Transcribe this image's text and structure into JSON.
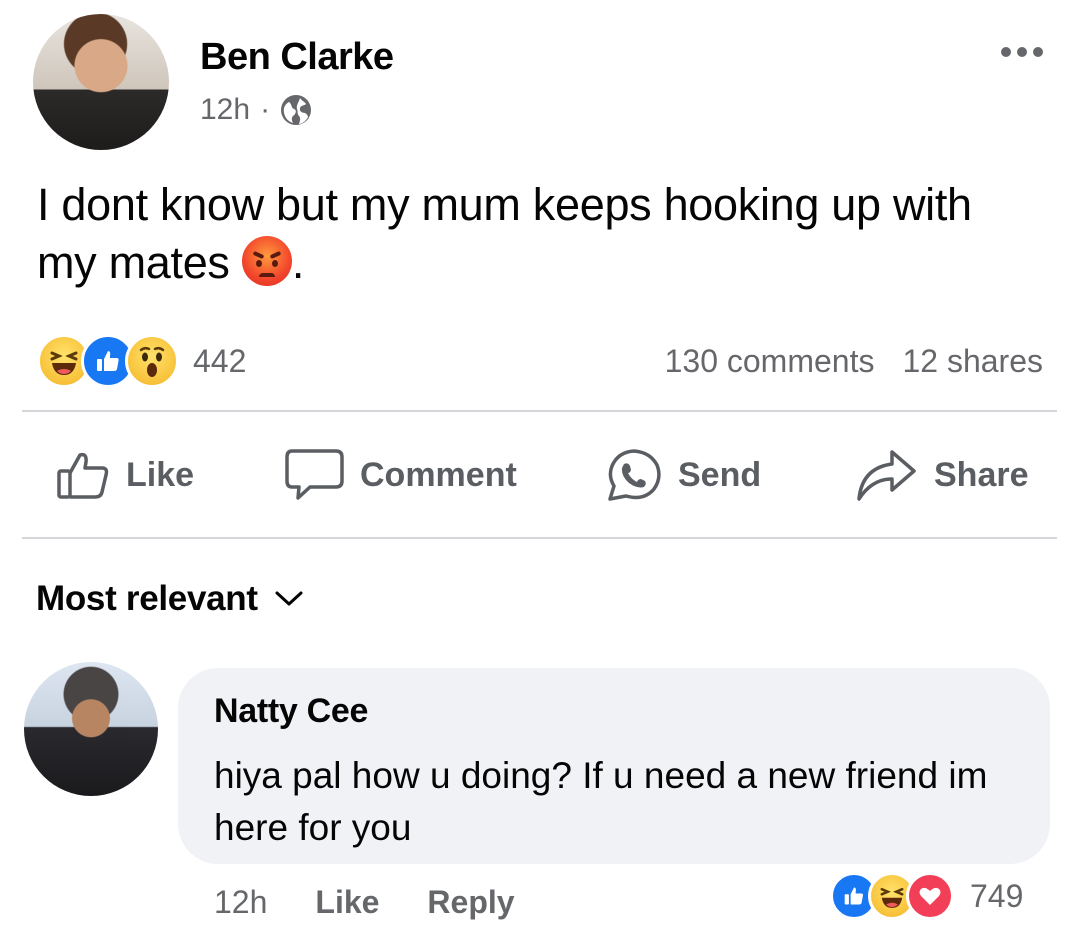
{
  "post": {
    "author": "Ben Clarke",
    "time": "12h",
    "dot": "·",
    "text": "I dont know but my mum keeps hooking up with my mates",
    "text_end": ".",
    "reactions": [
      "haha",
      "like",
      "wow"
    ],
    "reaction_count": "442",
    "comments_count": "130 comments",
    "shares_count": "12 shares"
  },
  "actions": {
    "like": "Like",
    "comment": "Comment",
    "send": "Send",
    "share": "Share"
  },
  "sort": {
    "label": "Most relevant"
  },
  "comment": {
    "author": "Natty Cee",
    "text": "hiya pal how u doing? If u need a new friend im here for you",
    "time": "12h",
    "like": "Like",
    "reply": "Reply",
    "reactions": [
      "like",
      "haha",
      "love"
    ],
    "reaction_count": "749"
  },
  "colors": {
    "accent": "#1877f2",
    "secondary_text": "#65676b",
    "bubble_bg": "#f0f2f5"
  }
}
